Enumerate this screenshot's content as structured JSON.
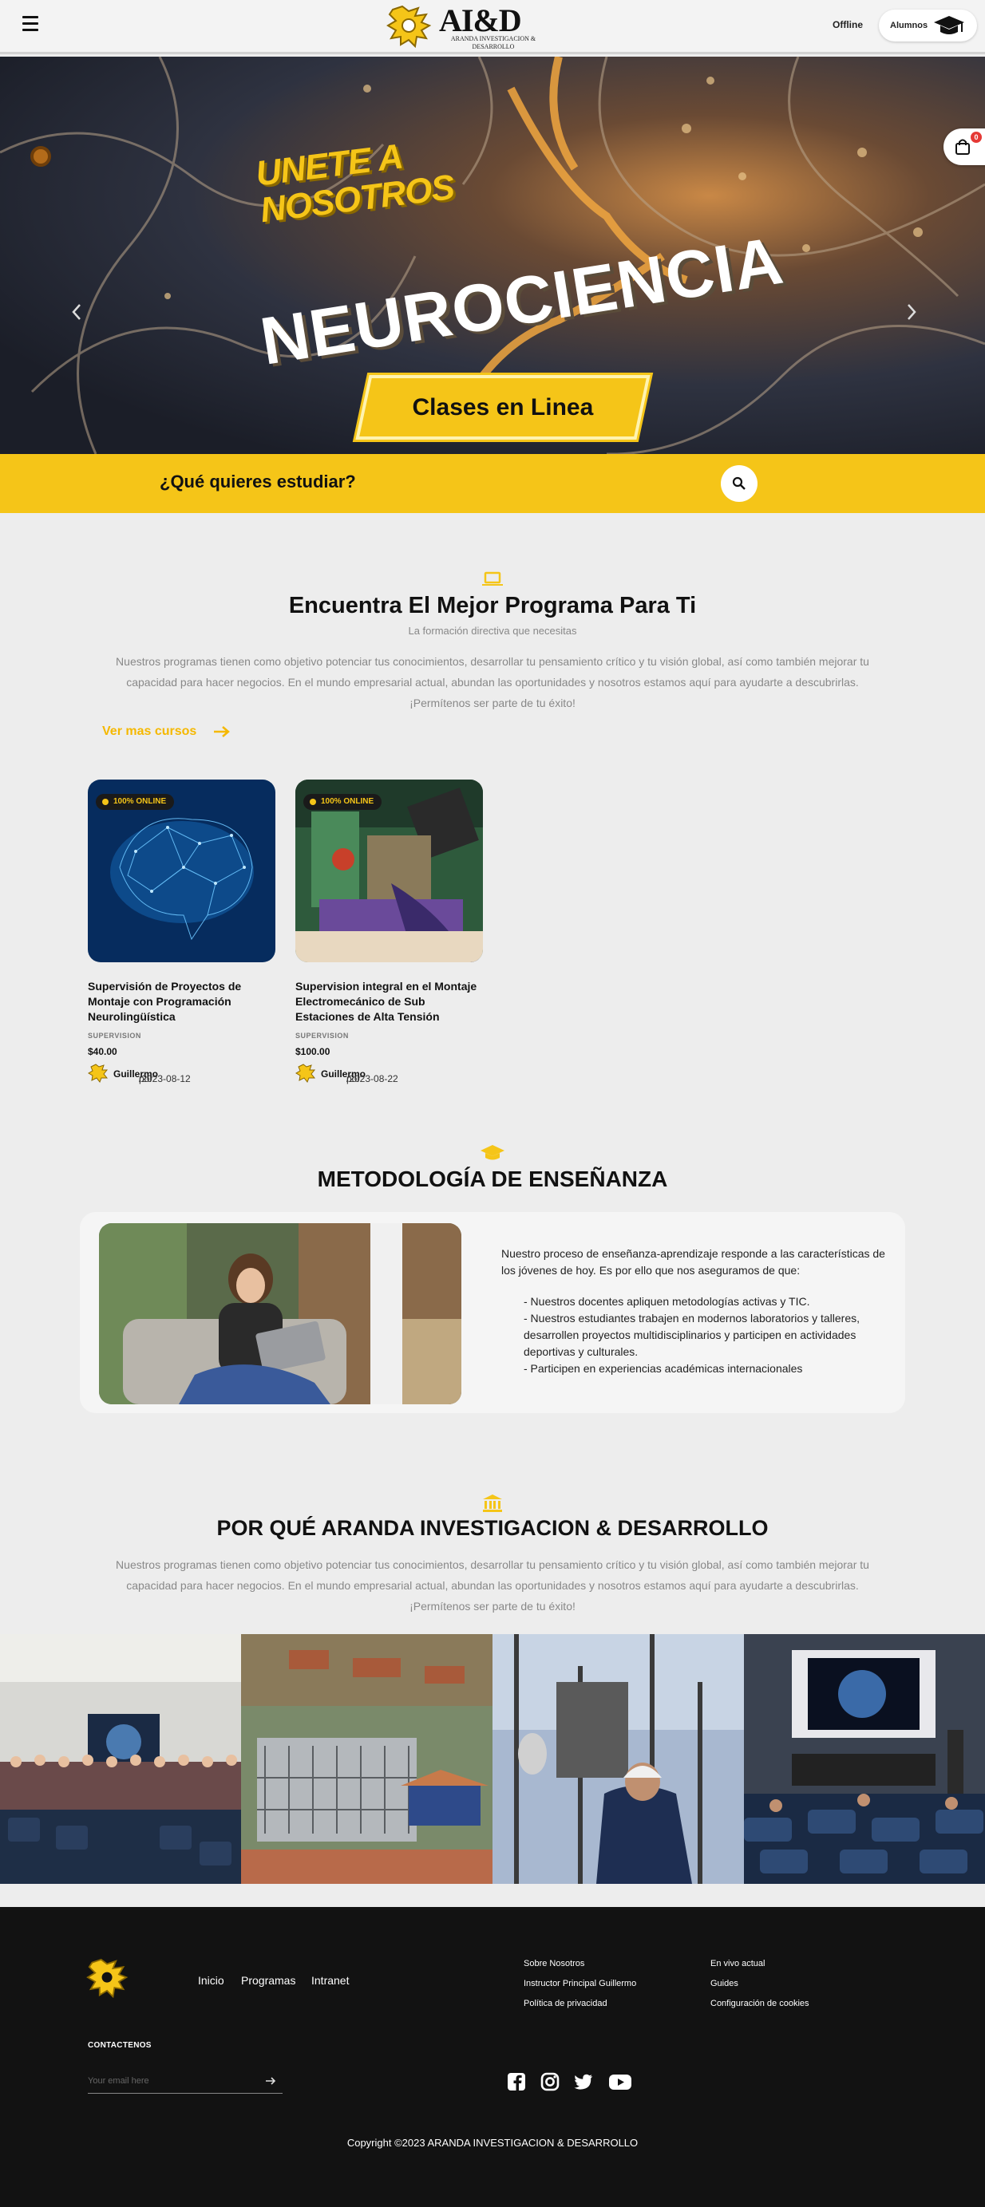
{
  "header": {
    "logo_text": "AI&D",
    "logo_sub": "ARANDA INVESTIGACION & DESARROLLO",
    "status": "Offline",
    "students_label": "Alumnos"
  },
  "hero": {
    "headline_small_1": "UNETE A",
    "headline_small_2": "NOSOTROS",
    "headline_big": "NEUROCIENCIA",
    "cta": "Clases en Linea",
    "cart_count": "0"
  },
  "search": {
    "question": "¿Qué quieres estudiar?"
  },
  "programs": {
    "title": "Encuentra El Mejor Programa Para Ti",
    "subtitle": "La formación directiva que necesitas",
    "description": "Nuestros programas tienen como objetivo potenciar tus conocimientos, desarrollar tu pensamiento crítico y tu visión global, así como también mejorar tu capacidad para hacer negocios. En el mundo empresarial actual, abundan las oportunidades y nosotros estamos aquí para ayudarte a descubrirlas. ¡Permítenos ser parte de tu éxito!",
    "see_more": "Ver mas cursos",
    "courses": [
      {
        "badge": "100% ONLINE",
        "title": "Supervisión de Proyectos de Montaje con Programación Neurolingüística",
        "category": "SUPERVISION",
        "price": "$40.00",
        "by": "por",
        "author": "Guillermo",
        "date": "/2023-08-12"
      },
      {
        "badge": "100% ONLINE",
        "title": "Supervision integral en el Montaje Electromecánico de Sub Estaciones de Alta Tensión",
        "category": "SUPERVISION",
        "price": "$100.00",
        "by": "por",
        "author": "Guillermo",
        "date": "/2023-08-22"
      }
    ]
  },
  "methodology": {
    "title": "METODOLOGÍA DE ENSEÑANZA",
    "intro": "Nuestro proceso de enseñanza-aprendizaje responde a las características de los jóvenes de hoy. Es por ello que nos aseguramos de que:",
    "points": [
      "- Nuestros docentes apliquen metodologías activas y TIC.",
      "- Nuestros estudiantes trabajen en modernos laboratorios y talleres, desarrollen proyectos multidisciplinarios y participen en actividades deportivas y culturales.",
      "- Participen en experiencias académicas internacionales"
    ]
  },
  "why": {
    "title": "POR QUÉ ARANDA INVESTIGACION & DESARROLLO",
    "description": "Nuestros programas tienen como objetivo potenciar tus conocimientos, desarrollar tu pensamiento crítico y tu visión global, así como también mejorar tu capacidad para hacer negocios. En el mundo empresarial actual, abundan las oportunidades y nosotros estamos aquí para ayudarte a descubrirlas. ¡Permítenos ser parte de tu éxito!"
  },
  "footer": {
    "nav": [
      "Inicio",
      "Programas",
      "Intranet"
    ],
    "col1": [
      "Sobre Nosotros",
      "Instructor Principal Guillermo",
      "Política de privacidad"
    ],
    "col2": [
      "En vivo actual",
      "Guides",
      "Configuración de cookies"
    ],
    "contact_title": "CONTACTENOS",
    "email_placeholder": "Your email here",
    "copyright": "Copyright ©2023 ARANDA INVESTIGACION & DESARROLLO"
  },
  "colors": {
    "accent": "#f5c518",
    "footer_bg": "#121212",
    "page_bg": "#ededed"
  }
}
